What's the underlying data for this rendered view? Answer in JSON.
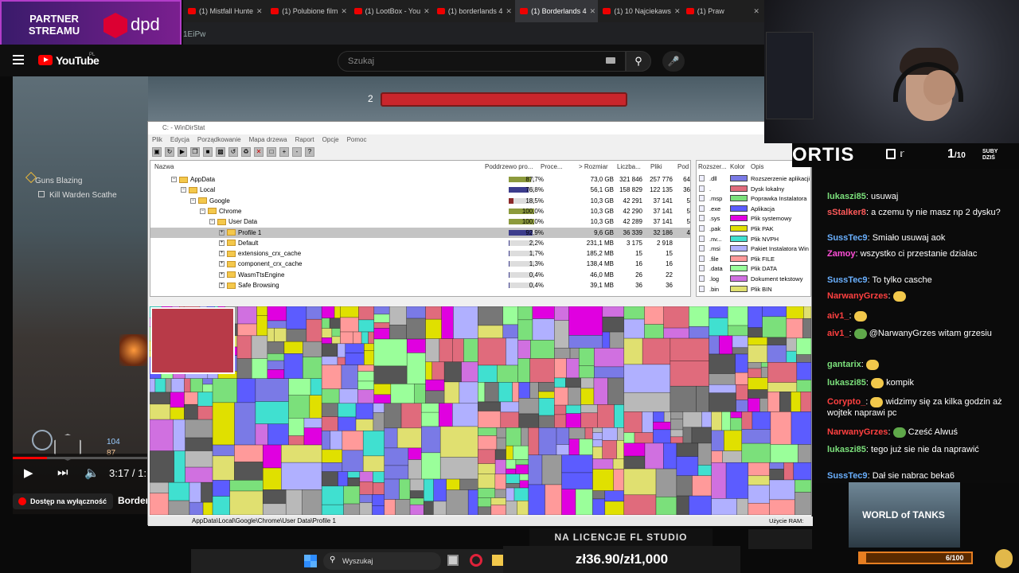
{
  "partner": {
    "line1": "PARTNER",
    "line2": "STREAMU",
    "brand": "dpd"
  },
  "browser": {
    "tabs": [
      {
        "label": "(1) Mistfall Hunte",
        "active": false
      },
      {
        "label": "(1) Polubione film",
        "active": false
      },
      {
        "label": "(1) LootBox - You",
        "active": false
      },
      {
        "label": "(1) borderlands 4",
        "active": false
      },
      {
        "label": "(1) Borderlands 4",
        "active": true
      },
      {
        "label": "(1) 10 Najciekaws",
        "active": false
      },
      {
        "label": "(1) Praw",
        "active": false
      }
    ],
    "url_fragment": "1EiPw"
  },
  "youtube": {
    "logo": "YouTube",
    "region": "PL",
    "search_placeholder": "Szukaj"
  },
  "game": {
    "boss_level": "2",
    "quest_title": "Guns Blazing",
    "quest_task": "Kill Warden Scathe",
    "hud_values": [
      "104",
      "87"
    ]
  },
  "player": {
    "time": "3:17 / 1:",
    "progress": 0.25,
    "exclusive": "Dostęp na wyłączność",
    "video_title": "Border"
  },
  "windirstat": {
    "title": "C: - WinDirStat",
    "menu": [
      "Plik",
      "Edycja",
      "Porządkowanie",
      "Mapa drzewa",
      "Raport",
      "Opcje",
      "Pomoc"
    ],
    "columns": [
      "Nazwa",
      "Poddrzewo pro...",
      "Proce...",
      "> Rozmiar",
      "Liczba...",
      "Pliki",
      "Pod"
    ],
    "rows": [
      {
        "name": "AppData",
        "indent": 0,
        "pct": "87,7%",
        "size": "73,0 GB",
        "items": "321 846",
        "files": "257 776",
        "sub": "64",
        "fill": 0.877,
        "color": "#8c9a3c",
        "selected": false
      },
      {
        "name": "Local",
        "indent": 1,
        "pct": "76,8%",
        "size": "56,1 GB",
        "items": "158 829",
        "files": "122 135",
        "sub": "36",
        "fill": 0.768,
        "color": "#3c3c8c",
        "selected": false
      },
      {
        "name": "Google",
        "indent": 2,
        "pct": "18,5%",
        "size": "10,3 GB",
        "items": "42 291",
        "files": "37 141",
        "sub": "5",
        "fill": 0.185,
        "color": "#8c2a2a",
        "selected": false
      },
      {
        "name": "Chrome",
        "indent": 3,
        "pct": "100,0%",
        "size": "10,3 GB",
        "items": "42 290",
        "files": "37 141",
        "sub": "5",
        "fill": 1.0,
        "color": "#8c9a3c",
        "selected": false
      },
      {
        "name": "User Data",
        "indent": 4,
        "pct": "100,0%",
        "size": "10,3 GB",
        "items": "42 289",
        "files": "37 141",
        "sub": "5",
        "fill": 1.0,
        "color": "#8c9a3c",
        "selected": false
      },
      {
        "name": "Profile 1",
        "indent": 5,
        "pct": "92,9%",
        "size": "9,6 GB",
        "items": "36 339",
        "files": "32 186",
        "sub": "4",
        "fill": 0.929,
        "color": "#3c3c8c",
        "selected": true
      },
      {
        "name": "Default",
        "indent": 5,
        "pct": "2,2%",
        "size": "231,1 MB",
        "items": "3 175",
        "files": "2 918",
        "sub": "",
        "fill": 0.022,
        "color": "#3c3c8c",
        "selected": false
      },
      {
        "name": "extensions_crx_cache",
        "indent": 5,
        "pct": "1,7%",
        "size": "185,2 MB",
        "items": "15",
        "files": "15",
        "sub": "",
        "fill": 0.017,
        "color": "#3c3c8c",
        "selected": false
      },
      {
        "name": "component_crx_cache",
        "indent": 5,
        "pct": "1,3%",
        "size": "138,4 MB",
        "items": "16",
        "files": "16",
        "sub": "",
        "fill": 0.013,
        "color": "#3c3c8c",
        "selected": false
      },
      {
        "name": "WasmTtsEngine",
        "indent": 5,
        "pct": "0,4%",
        "size": "46,0 MB",
        "items": "26",
        "files": "22",
        "sub": "",
        "fill": 0.004,
        "color": "#3c3c8c",
        "selected": false
      },
      {
        "name": "Safe Browsing",
        "indent": 5,
        "pct": "0,4%",
        "size": "39,1 MB",
        "items": "36",
        "files": "36",
        "sub": "",
        "fill": 0.004,
        "color": "#3c3c8c",
        "selected": false
      }
    ],
    "ext_columns": [
      "Rozszer...",
      "Kolor",
      "Opis"
    ],
    "extensions": [
      {
        "ext": ".dll",
        "color": "#7a7ae6",
        "desc": "Rozszerzenie aplikacji"
      },
      {
        "ext": ".",
        "color": "#e06b7c",
        "desc": "Dysk lokalny"
      },
      {
        "ext": ".msp",
        "color": "#7be07b",
        "desc": "Poprawka Instalatora"
      },
      {
        "ext": ".exe",
        "color": "#5c5cff",
        "desc": "Aplikacja"
      },
      {
        "ext": ".sys",
        "color": "#e000e0",
        "desc": "Plik systemowy"
      },
      {
        "ext": ".pak",
        "color": "#e0e000",
        "desc": "Plik PAK"
      },
      {
        "ext": ".nv...",
        "color": "#40e0d0",
        "desc": "Plik NVPH"
      },
      {
        "ext": ".msi",
        "color": "#b0b0ff",
        "desc": "Pakiet Instalatora Win"
      },
      {
        "ext": ".file",
        "color": "#ff9a9a",
        "desc": "Plik FILE"
      },
      {
        "ext": ".data",
        "color": "#9aff9a",
        "desc": "Plik DATA"
      },
      {
        "ext": ".log",
        "color": "#d070e0",
        "desc": "Dokument tekstowy"
      },
      {
        "ext": ".bin",
        "color": "#e0e070",
        "desc": "Plik BIN"
      }
    ],
    "status_path": "AppData\\Local\\Google\\Chrome\\User Data\\Profile 1",
    "ram_label": "Użycie RAM:"
  },
  "stream": {
    "name": "ORTIS",
    "subs_current": "1",
    "subs_goal": "/10",
    "subs_label": "SUBY DZIŚ"
  },
  "chat": [
    {
      "user": "lukaszi85",
      "color": "#7be07b",
      "text": "usuwaj",
      "emote": ""
    },
    {
      "user": "sStalker8",
      "color": "#ff5a5a",
      "text": "a czemu ty nie masz np 2 dysku?",
      "emote": ""
    },
    {
      "user": "SussTec9",
      "color": "#6ab0ff",
      "text": "Smiało usuwaj aok",
      "emote": ""
    },
    {
      "user": "Zamoy",
      "color": "#ff4fd8",
      "text": "wszystko ci przestanie dzialac",
      "emote": ""
    },
    {
      "user": "SussTec9",
      "color": "#6ab0ff",
      "text": "To tylko casche",
      "emote": ""
    },
    {
      "user": "NarwanyGrzes",
      "color": "#ff4040",
      "text": "",
      "emote": "#f2c84b"
    },
    {
      "user": "aiv1_",
      "color": "#ff4040",
      "text": "",
      "emote": "#f2c84b"
    },
    {
      "user": "aiv1_",
      "color": "#ff4040",
      "text": "@NarwanyGrzes witam grzesiu",
      "emote": "#5fa84a"
    },
    {
      "user": "gantarix",
      "color": "#7be07b",
      "text": "",
      "emote": "#f2c84b"
    },
    {
      "user": "lukaszi85",
      "color": "#7be07b",
      "text": "kompik",
      "emote": "#f2c84b"
    },
    {
      "user": "Corypto_",
      "color": "#ff4040",
      "text": "widzimy się za kilka godzin aż wojtek naprawi pc",
      "emote": "#f2c84b"
    },
    {
      "user": "NarwanyGrzes",
      "color": "#ff4040",
      "text": "Cześć Alwuś",
      "emote": "#5fa84a"
    },
    {
      "user": "lukaszi85",
      "color": "#7be07b",
      "text": "tego już sie nie da naprawić",
      "emote": ""
    },
    {
      "user": "SussTec9",
      "color": "#6ab0ff",
      "text": "Dał sie nabrac beka6",
      "emote": ""
    }
  ],
  "promo": {
    "game": "WORLD of TANKS",
    "goal_text": "6/100",
    "goal_fraction": 0.06
  },
  "overlay": {
    "license": "NA LICENCJE FL STUDIO",
    "price": "zł36.90/zł1,000"
  },
  "taskbar": {
    "search": "Wyszukaj"
  }
}
